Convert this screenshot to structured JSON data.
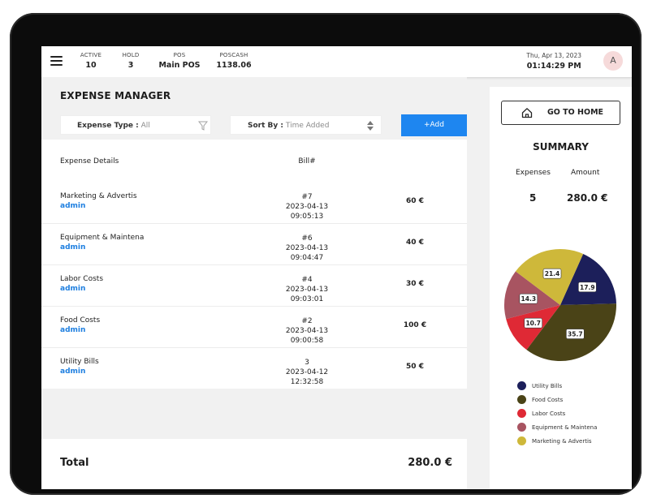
{
  "header": {
    "stats": [
      {
        "label": "ACTIVE",
        "value": "10"
      },
      {
        "label": "HOLD",
        "value": "3"
      },
      {
        "label": "POS",
        "value": "Main POS"
      },
      {
        "label": "POSCASH",
        "value": "1138.06"
      }
    ],
    "date": "Thu, Apr 13, 2023",
    "time": "01:14:29 PM",
    "avatar_initial": "A"
  },
  "main": {
    "title": "EXPENSE MANAGER",
    "filter_expense_type": {
      "label": "Expense Type :",
      "value": "All"
    },
    "sort_by": {
      "label": "Sort By :",
      "value": "Time Added"
    },
    "add_label": "+Add",
    "table": {
      "headers": {
        "details": "Expense Details",
        "bill": "Bill#"
      },
      "rows": [
        {
          "name": "Marketing & Advertis",
          "user": "admin",
          "bill_no": "#7",
          "datetime": "2023-04-13 09:05:13",
          "amount": "60 €"
        },
        {
          "name": "Equipment & Maintena",
          "user": "admin",
          "bill_no": "#6",
          "datetime": "2023-04-13 09:04:47",
          "amount": "40 €"
        },
        {
          "name": "Labor Costs",
          "user": "admin",
          "bill_no": "#4",
          "datetime": "2023-04-13 09:03:01",
          "amount": "30 €"
        },
        {
          "name": "Food Costs",
          "user": "admin",
          "bill_no": "#2",
          "datetime": "2023-04-13 09:00:58",
          "amount": "100 €"
        },
        {
          "name": "Utility Bills",
          "user": "admin",
          "bill_no": "3",
          "datetime": "2023-04-12 12:32:58",
          "amount": "50 €"
        }
      ]
    },
    "total_label": "Total",
    "total_value": "280.0 €"
  },
  "sidebar": {
    "go_home_label": "GO TO HOME",
    "summary_title": "SUMMARY",
    "expenses_label": "Expenses",
    "amount_label": "Amount",
    "expenses_count": "5",
    "amount_total": "280.0 €"
  },
  "chart_data": {
    "type": "pie",
    "series": [
      {
        "name": "Utility Bills",
        "value": 17.9,
        "color": "#1c1f5a"
      },
      {
        "name": "Food Costs",
        "value": 35.7,
        "color": "#4a4317"
      },
      {
        "name": "Labor Costs",
        "value": 10.7,
        "color": "#df2935"
      },
      {
        "name": "Equipment & Maintena",
        "value": 14.3,
        "color": "#a85461"
      },
      {
        "name": "Marketing & Advertis",
        "value": 21.4,
        "color": "#ceb83a"
      }
    ],
    "labels": [
      "17.9",
      "35.7",
      "10.7",
      "14.3",
      "21.4"
    ],
    "legend_position": "bottom"
  }
}
